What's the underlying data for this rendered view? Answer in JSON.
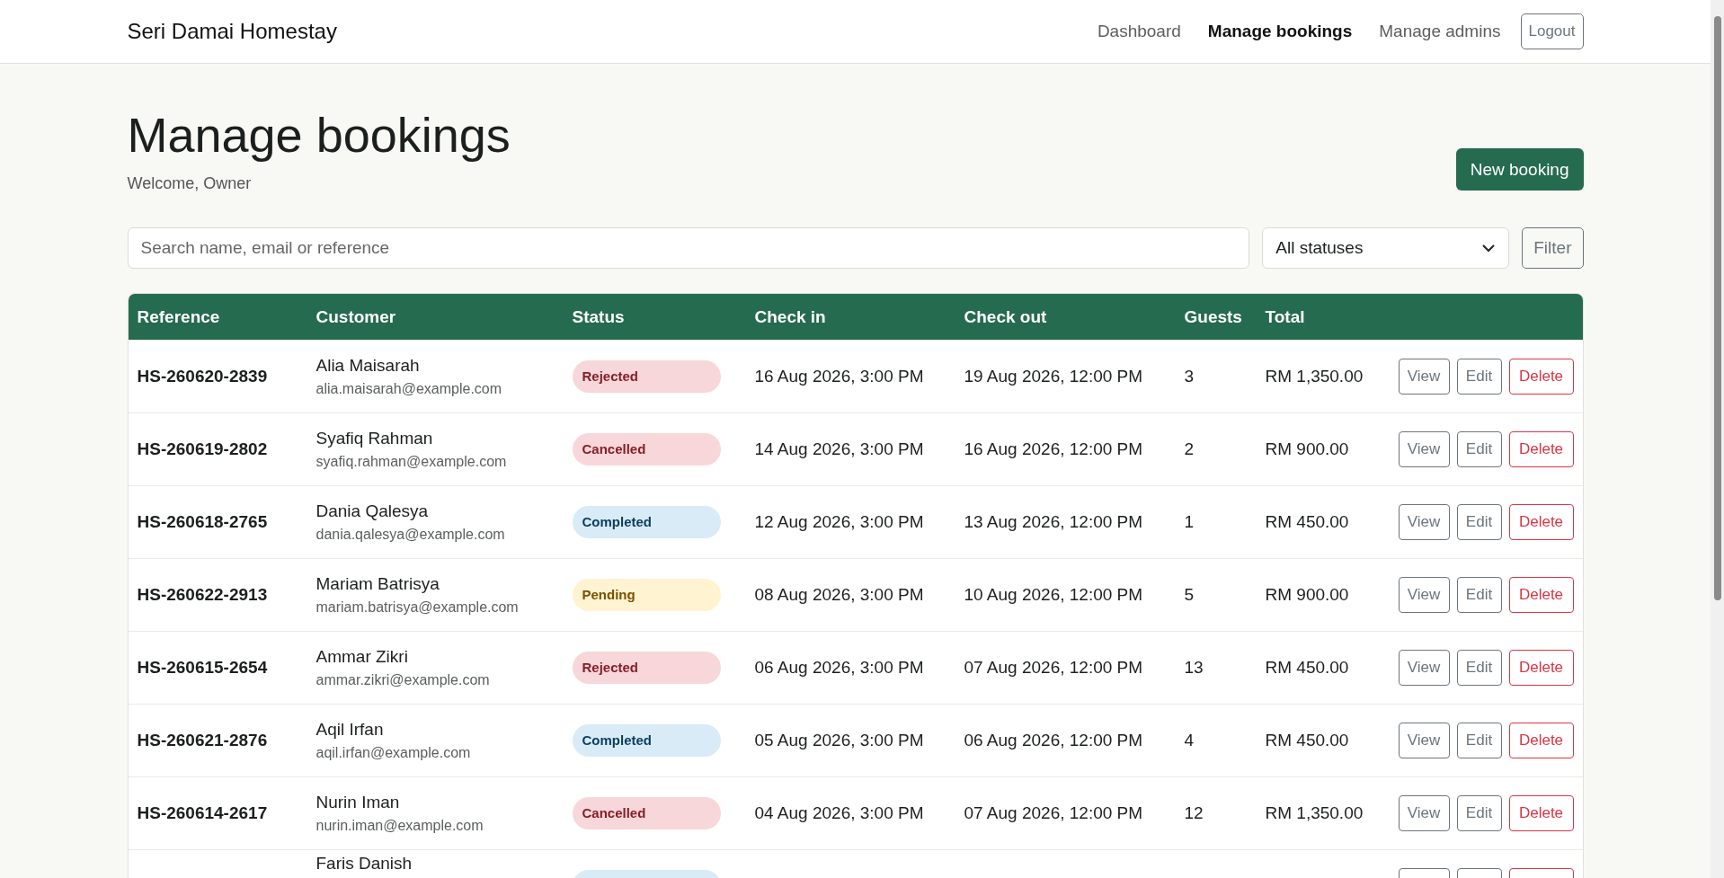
{
  "brand": "Seri Damai Homestay",
  "nav": [
    {
      "label": "Dashboard",
      "selected": false
    },
    {
      "label": "Manage bookings",
      "selected": true
    },
    {
      "label": "Manage admins",
      "selected": false
    }
  ],
  "logout": "Logout",
  "page_title": "Manage bookings",
  "welcome": "Welcome, Owner",
  "new_button": "New booking",
  "search": {
    "placeholder": "Search name, email or reference"
  },
  "status_filter": {
    "value": "All statuses"
  },
  "filter_button": "Filter",
  "table": {
    "columns": [
      "Reference",
      "Customer",
      "Status",
      "Check in",
      "Check out",
      "Guests",
      "Total"
    ],
    "rows": [
      {
        "reference": "HS-260620-2839",
        "name": "Alia Maisarah",
        "email": "alia.maisarah@example.com",
        "status": {
          "label": "Rejected",
          "kind": "rejected"
        },
        "check_in": "16 Aug 2026, 3:00 PM",
        "check_out": "19 Aug 2026, 12:00 PM",
        "guests": "3",
        "total": "RM 1,350.00",
        "actions": [
          {
            "label": "View",
            "kind": "view"
          },
          {
            "label": "Edit",
            "kind": "edit"
          },
          {
            "label": "Delete",
            "kind": "delete"
          }
        ]
      },
      {
        "reference": "HS-260619-2802",
        "name": "Syafiq Rahman",
        "email": "syafiq.rahman@example.com",
        "status": {
          "label": "Cancelled",
          "kind": "cancelled"
        },
        "check_in": "14 Aug 2026, 3:00 PM",
        "check_out": "16 Aug 2026, 12:00 PM",
        "guests": "2",
        "total": "RM 900.00",
        "actions": [
          {
            "label": "View",
            "kind": "view"
          },
          {
            "label": "Edit",
            "kind": "edit"
          },
          {
            "label": "Delete",
            "kind": "delete"
          }
        ]
      },
      {
        "reference": "HS-260618-2765",
        "name": "Dania Qalesya",
        "email": "dania.qalesya@example.com",
        "status": {
          "label": "Completed",
          "kind": "completed"
        },
        "check_in": "12 Aug 2026, 3:00 PM",
        "check_out": "13 Aug 2026, 12:00 PM",
        "guests": "1",
        "total": "RM 450.00",
        "actions": [
          {
            "label": "View",
            "kind": "view"
          },
          {
            "label": "Edit",
            "kind": "edit"
          },
          {
            "label": "Delete",
            "kind": "delete"
          }
        ]
      },
      {
        "reference": "HS-260622-2913",
        "name": "Mariam Batrisya",
        "email": "mariam.batrisya@example.com",
        "status": {
          "label": "Pending",
          "kind": "pending"
        },
        "check_in": "08 Aug 2026, 3:00 PM",
        "check_out": "10 Aug 2026, 12:00 PM",
        "guests": "5",
        "total": "RM 900.00",
        "actions": [
          {
            "label": "View",
            "kind": "view"
          },
          {
            "label": "Edit",
            "kind": "edit"
          },
          {
            "label": "Delete",
            "kind": "delete"
          }
        ]
      },
      {
        "reference": "HS-260615-2654",
        "name": "Ammar Zikri",
        "email": "ammar.zikri@example.com",
        "status": {
          "label": "Rejected",
          "kind": "rejected"
        },
        "check_in": "06 Aug 2026, 3:00 PM",
        "check_out": "07 Aug 2026, 12:00 PM",
        "guests": "13",
        "total": "RM 450.00",
        "actions": [
          {
            "label": "View",
            "kind": "view"
          },
          {
            "label": "Edit",
            "kind": "edit"
          },
          {
            "label": "Delete",
            "kind": "delete"
          }
        ]
      },
      {
        "reference": "HS-260621-2876",
        "name": "Aqil Irfan",
        "email": "aqil.irfan@example.com",
        "status": {
          "label": "Completed",
          "kind": "completed"
        },
        "check_in": "05 Aug 2026, 3:00 PM",
        "check_out": "06 Aug 2026, 12:00 PM",
        "guests": "4",
        "total": "RM 450.00",
        "actions": [
          {
            "label": "View",
            "kind": "view"
          },
          {
            "label": "Edit",
            "kind": "edit"
          },
          {
            "label": "Delete",
            "kind": "delete"
          }
        ]
      },
      {
        "reference": "HS-260614-2617",
        "name": "Nurin Iman",
        "email": "nurin.iman@example.com",
        "status": {
          "label": "Cancelled",
          "kind": "cancelled"
        },
        "check_in": "04 Aug 2026, 3:00 PM",
        "check_out": "07 Aug 2026, 12:00 PM",
        "guests": "12",
        "total": "RM 1,350.00",
        "actions": [
          {
            "label": "View",
            "kind": "view"
          },
          {
            "label": "Edit",
            "kind": "edit"
          },
          {
            "label": "Delete",
            "kind": "delete"
          }
        ]
      },
      {
        "name": "Faris Danish",
        "status": {
          "kind": "completed"
        },
        "actions": [
          {
            "kind": "view"
          },
          {
            "kind": "edit"
          },
          {
            "kind": "delete"
          }
        ]
      }
    ]
  }
}
